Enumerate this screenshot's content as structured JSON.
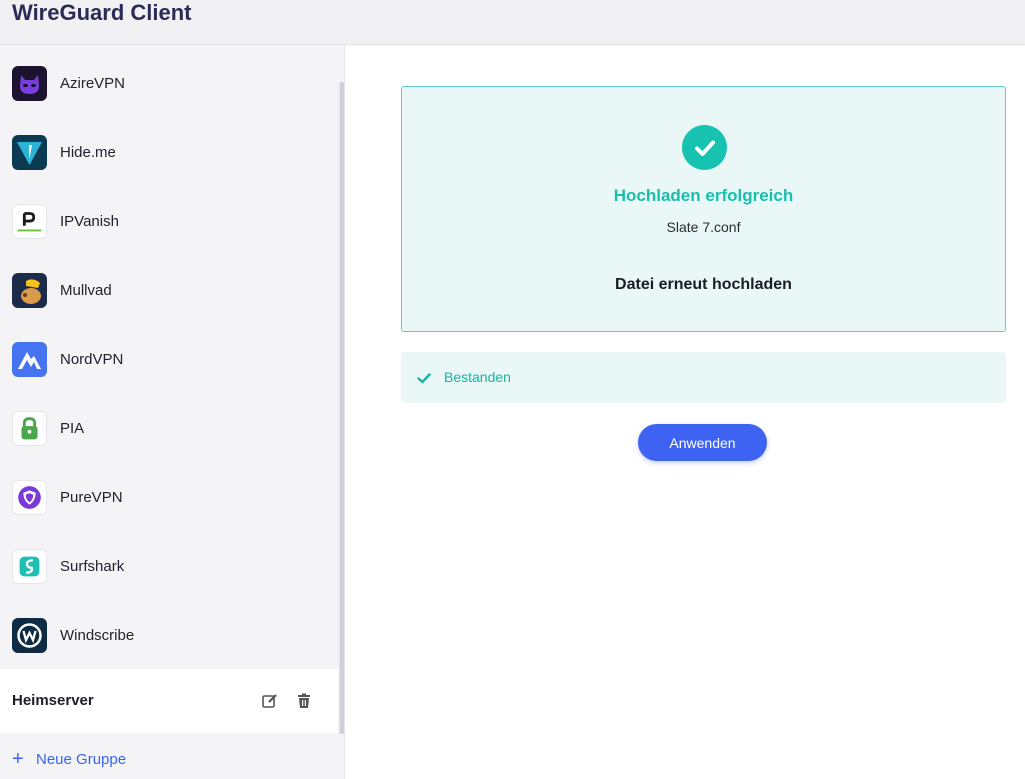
{
  "app": {
    "title": "WireGuard Client"
  },
  "sidebar": {
    "providers": [
      {
        "name": "AzireVPN",
        "icon": "azirevpn-logo-icon"
      },
      {
        "name": "Hide.me",
        "icon": "hideme-logo-icon"
      },
      {
        "name": "IPVanish",
        "icon": "ipvanish-logo-icon"
      },
      {
        "name": "Mullvad",
        "icon": "mullvad-logo-icon"
      },
      {
        "name": "NordVPN",
        "icon": "nordvpn-logo-icon"
      },
      {
        "name": "PIA",
        "icon": "pia-logo-icon"
      },
      {
        "name": "PureVPN",
        "icon": "purevpn-logo-icon"
      },
      {
        "name": "Surfshark",
        "icon": "surfshark-logo-icon"
      },
      {
        "name": "Windscribe",
        "icon": "windscribe-logo-icon"
      }
    ],
    "group": {
      "name": "Heimserver"
    },
    "new_group_label": "Neue Gruppe"
  },
  "upload": {
    "status_title": "Hochladen erfolgreich",
    "file_name": "Slate 7.conf",
    "reupload_label": "Datei erneut hochladen"
  },
  "validation": {
    "status": "Bestanden"
  },
  "apply_label": "Anwenden",
  "colors": {
    "accent": "#3e63f3",
    "success": "#17c3b0",
    "success_bg": "#e9f7f6"
  }
}
